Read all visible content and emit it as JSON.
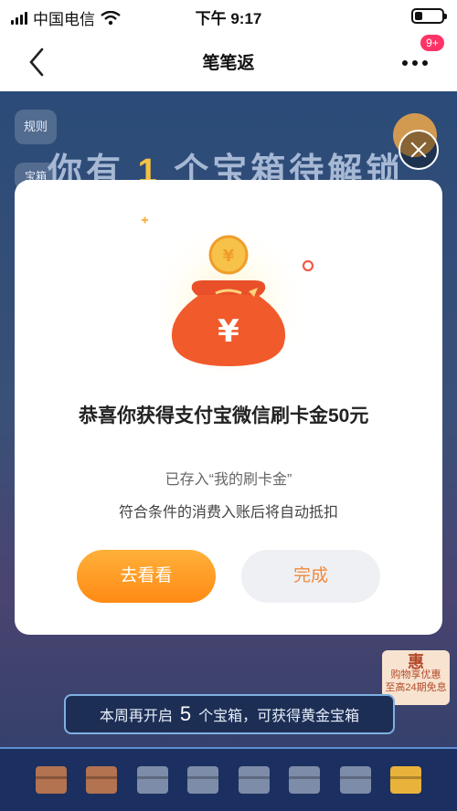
{
  "status_bar": {
    "carrier": "中国电信",
    "time": "下午 9:17"
  },
  "nav": {
    "title": "笔笔返",
    "badge": "9+"
  },
  "background": {
    "rules_label": "规则",
    "second_label": "宝箱",
    "headline_pre": "你有",
    "headline_num": "1",
    "headline_post": "个宝箱待解锁",
    "promo_line1": "惠",
    "promo_line2": "购物享优惠",
    "promo_line3": "至高24期免息",
    "week_pre": "本周再开启",
    "week_count": "5",
    "week_post": "个宝箱，可获得黄金宝箱",
    "chests": [
      "open",
      "open",
      "closed",
      "closed",
      "closed",
      "closed",
      "closed",
      "gold"
    ]
  },
  "modal": {
    "message": "恭喜你获得支付宝微信刷卡金50元",
    "stored_note": "已存入“我的刷卡金”",
    "deduct_note": "符合条件的消费入账后将自动抵扣",
    "view_button": "去看看",
    "done_button": "完成",
    "bag_symbol": "¥"
  },
  "colors": {
    "accent_orange": "#ff8a14",
    "bag_red": "#f15a2b",
    "coin_gold": "#f7c24a"
  }
}
